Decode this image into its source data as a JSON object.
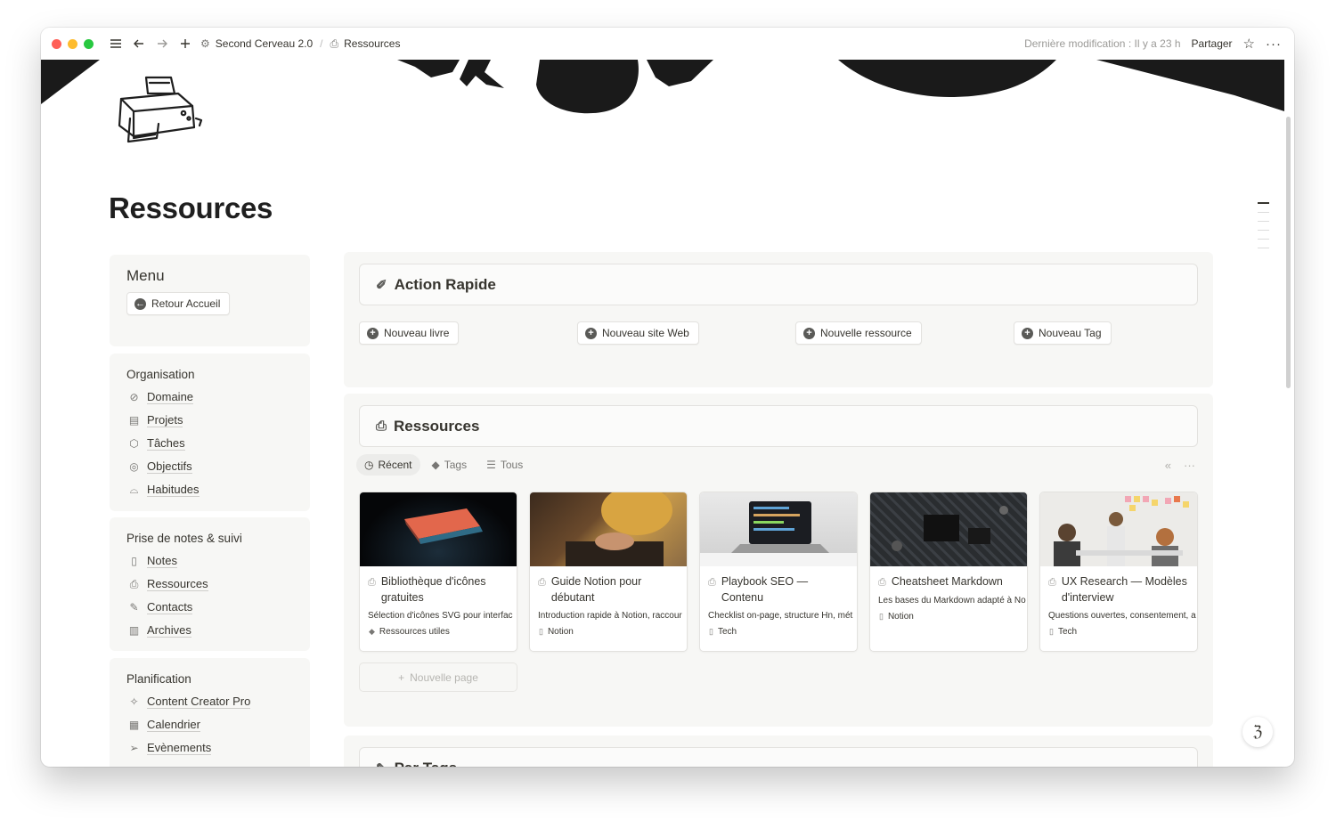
{
  "titlebar": {
    "workspace": "Second Cerveau 2.0",
    "page": "Ressources",
    "modified": "Dernière modification : Il y a 23 h",
    "share": "Partager",
    "star_icon": "star-icon",
    "more_icon": "more-icon"
  },
  "page": {
    "title": "Ressources"
  },
  "menu": {
    "title": "Menu",
    "back_button": "Retour Accueil"
  },
  "organisation": {
    "title": "Organisation",
    "items": [
      {
        "label": "Domaine",
        "icon": "compass-icon"
      },
      {
        "label": "Projets",
        "icon": "projects-icon"
      },
      {
        "label": "Tâches",
        "icon": "tasks-icon"
      },
      {
        "label": "Objectifs",
        "icon": "target-icon"
      },
      {
        "label": "Habitudes",
        "icon": "shoe-icon"
      }
    ]
  },
  "notes": {
    "title": "Prise de notes & suivi",
    "items": [
      {
        "label": "Notes",
        "icon": "note-icon"
      },
      {
        "label": "Ressources",
        "icon": "printer-icon"
      },
      {
        "label": "Contacts",
        "icon": "contacts-icon"
      },
      {
        "label": "Archives",
        "icon": "archive-icon"
      }
    ]
  },
  "planification": {
    "title": "Planification",
    "items": [
      {
        "label": "Content Creator Pro",
        "icon": "creator-icon"
      },
      {
        "label": "Calendrier",
        "icon": "calendar-icon"
      },
      {
        "label": "Evènements",
        "icon": "send-icon"
      }
    ]
  },
  "quick_action": {
    "title": "Action Rapide",
    "buttons": [
      "Nouveau livre",
      "Nouveau site Web",
      "Nouvelle ressource",
      "Nouveau Tag"
    ]
  },
  "resources": {
    "title": "Ressources",
    "tabs": [
      {
        "label": "Récent",
        "icon": "clock-icon",
        "active": true
      },
      {
        "label": "Tags",
        "icon": "tag-icon",
        "active": false
      },
      {
        "label": "Tous",
        "icon": "list-icon",
        "active": false
      }
    ],
    "cards": [
      {
        "title": "Bibliothèque d'icônes gratuites",
        "desc": "Sélection d'icônes SVG pour interfac",
        "tag": "Ressources utiles",
        "tag_icon": "tag-icon"
      },
      {
        "title": "Guide Notion pour débutant",
        "desc": "Introduction rapide à Notion, raccour",
        "tag": "Notion",
        "tag_icon": "page-icon"
      },
      {
        "title": "Playbook SEO — Contenu",
        "desc": "Checklist on-page, structure Hn, mét",
        "tag": "Tech",
        "tag_icon": "page-icon"
      },
      {
        "title": "Cheatsheet Markdown",
        "desc": "Les bases du Markdown adapté à No",
        "tag": "Notion",
        "tag_icon": "page-icon"
      },
      {
        "title": "UX Research — Modèles d'interview",
        "desc": "Questions ouvertes, consentement, a",
        "tag": "Tech",
        "tag_icon": "page-icon"
      }
    ],
    "new_page": "Nouvelle page"
  },
  "by_tags": {
    "title": "Par Tags"
  },
  "colors": {
    "sidebar_bg": "#f7f7f5",
    "text": "#37352f",
    "muted": "#9b9a97"
  }
}
